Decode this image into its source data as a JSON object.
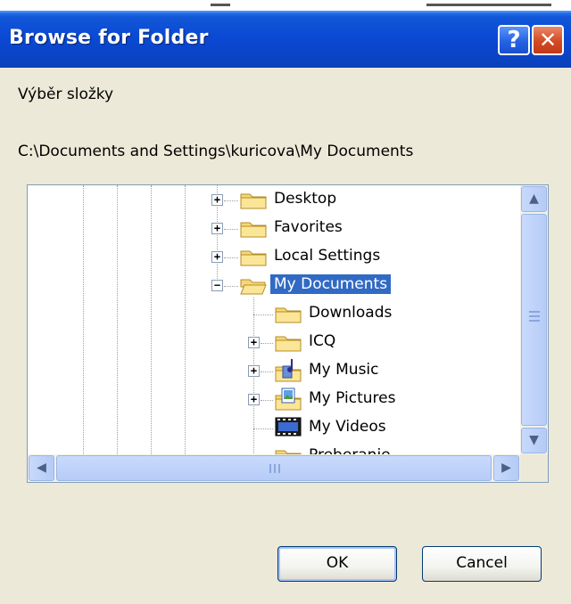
{
  "window": {
    "title": "Browse for Folder",
    "help_glyph": "?",
    "close_glyph": "✕"
  },
  "instruction": "Výběr složky",
  "current_path": "C:\\Documents and Settings\\kuricova\\My Documents",
  "tree": {
    "items": [
      {
        "label": "Desktop",
        "expander": "+",
        "icon": "folder-icon"
      },
      {
        "label": "Favorites",
        "expander": "+",
        "icon": "folder-icon"
      },
      {
        "label": "Local Settings",
        "expander": "+",
        "icon": "folder-icon"
      },
      {
        "label": "My Documents",
        "expander": "−",
        "icon": "open-folder-icon",
        "selected": true
      },
      {
        "label": "Downloads",
        "expander": "",
        "icon": "folder-icon"
      },
      {
        "label": "ICQ",
        "expander": "+",
        "icon": "folder-icon"
      },
      {
        "label": "My Music",
        "expander": "+",
        "icon": "music-folder-icon"
      },
      {
        "label": "My Pictures",
        "expander": "+",
        "icon": "pictures-folder-icon"
      },
      {
        "label": "My Videos",
        "expander": "",
        "icon": "videos-folder-icon"
      },
      {
        "label": "Preberanie",
        "expander": "",
        "icon": "folder-icon"
      }
    ]
  },
  "buttons": {
    "ok": "OK",
    "cancel": "Cancel"
  },
  "colors": {
    "title_bar": "#0a49d4",
    "selection": "#316ac5",
    "dialog_bg": "#ece9d8"
  }
}
